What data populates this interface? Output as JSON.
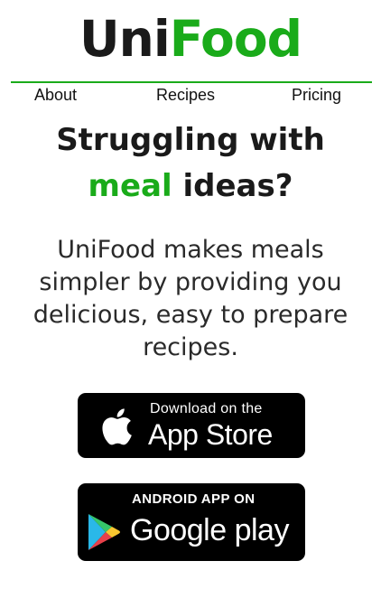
{
  "brand": {
    "part1": "Uni",
    "part2": "Food",
    "accent_color": "#1aab1a"
  },
  "nav": {
    "items": [
      {
        "label": "About"
      },
      {
        "label": "Recipes"
      },
      {
        "label": "Pricing"
      }
    ]
  },
  "hero": {
    "headline_line1": "Struggling with",
    "headline_accent": "meal",
    "headline_rest": " ideas?",
    "description_lines": [
      "UniFood makes meals",
      "simpler by providing you",
      "delicious, easy to prepare",
      "recipes."
    ]
  },
  "badges": {
    "apple": {
      "small": "Download on the",
      "big": "App Store",
      "icon": "apple-icon"
    },
    "google": {
      "small": "ANDROID APP ON",
      "big": "Google play",
      "icon": "google-play-icon"
    }
  }
}
